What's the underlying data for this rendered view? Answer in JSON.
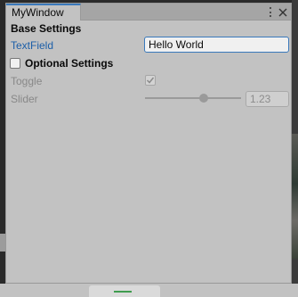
{
  "window": {
    "tab_title": "MyWindow",
    "menu_icon": "kebab-menu-icon",
    "close_icon": "close-icon"
  },
  "base_settings": {
    "title": "Base Settings",
    "text_field": {
      "label": "TextField",
      "value": "Hello World"
    }
  },
  "optional_settings": {
    "label": "Optional Settings",
    "enabled": false,
    "toggle": {
      "label": "Toggle",
      "checked": true
    },
    "slider": {
      "label": "Slider",
      "value": "1.23",
      "min": 0,
      "max": 2
    }
  },
  "colors": {
    "accent": "#3a79bb",
    "label_blue": "#1c5ea8",
    "panel_bg": "#c2c2c2",
    "disabled_text": "#888888"
  }
}
